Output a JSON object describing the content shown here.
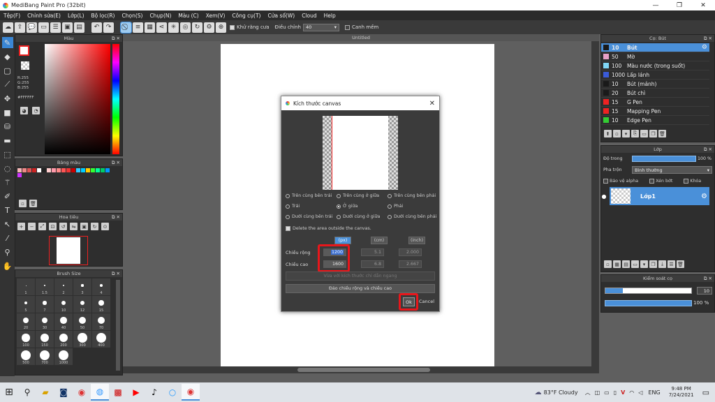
{
  "window": {
    "title": "MediBang Paint Pro (32bit)",
    "minimize": "—",
    "maximize": "❐",
    "close": "✕"
  },
  "menu": [
    "Tệp(F)",
    "Chỉnh sửa(E)",
    "Lớp(L)",
    "Bộ lọc(R)",
    "Chọn(S)",
    "Chụp(N)",
    "Màu (C)",
    "Xem(V)",
    "Công cụ(T)",
    "Cửa sổ(W)",
    "Cloud",
    "Help"
  ],
  "toolbar": {
    "antialias_label": "Khử răng cưa",
    "adjust_label": "Điều chỉnh",
    "adjust_value": "40",
    "smooth_label": "Canh mềm"
  },
  "color_panel": {
    "title": "Màu",
    "rgb": {
      "r": "R:255",
      "g": "G:255",
      "b": "B:255"
    },
    "hex": "#FFFFFF"
  },
  "palette_panel": {
    "title": "Bảng màu",
    "colors": [
      "#f4b6b6",
      "#e88",
      "#d55",
      "#c22",
      "#fff",
      "#222",
      "#fcc",
      "#f9a",
      "#f88",
      "#f55",
      "#e33",
      "#c00",
      "#3cf",
      "#0cf",
      "#fc0",
      "#3f3",
      "#0f9",
      "#0c6",
      "#09f",
      "#c3f"
    ]
  },
  "navigator_panel": {
    "title": "Hoa tiêu"
  },
  "brushsize_panel": {
    "title": "Brush Size",
    "sizes": [
      "1",
      "1.5",
      "2",
      "3",
      "4",
      "5",
      "7",
      "10",
      "12",
      "15",
      "20",
      "30",
      "40",
      "50",
      "70",
      "100",
      "150",
      "200",
      "300",
      "400",
      "500",
      "700",
      "1000"
    ]
  },
  "canvas": {
    "tab_title": "Untitled"
  },
  "brush_panel": {
    "title": "Cọ: Bút",
    "items": [
      {
        "num": "10",
        "name": "Bút",
        "color": "#1a1a1a",
        "selected": true
      },
      {
        "num": "50",
        "name": "Mờ",
        "color": "#e8a0c8",
        "selected": false
      },
      {
        "num": "100",
        "name": "Màu nước (trong suốt)",
        "color": "#7fd6f5",
        "selected": false
      },
      {
        "num": "1000",
        "name": "Lấp lánh",
        "color": "#3a5bd9",
        "selected": false
      },
      {
        "num": "10",
        "name": "Bút (mảnh)",
        "color": "#1a1a1a",
        "selected": false
      },
      {
        "num": "20",
        "name": "Bút chì",
        "color": "#1a1a1a",
        "selected": false
      },
      {
        "num": "15",
        "name": "G Pen",
        "color": "#e22",
        "selected": false
      },
      {
        "num": "15",
        "name": "Mapping Pen",
        "color": "#e22",
        "selected": false
      },
      {
        "num": "10",
        "name": "Edge Pen",
        "color": "#3c3",
        "selected": false
      }
    ]
  },
  "layer_panel": {
    "title": "Lớp",
    "opacity_label": "Độ trong",
    "opacity_value": "100 %",
    "blend_label": "Pha trộn",
    "blend_value": "Bình thường",
    "protect_alpha": "Bảo vệ alpha",
    "clipping": "Xén bớt",
    "lock": "Khóa",
    "layer_name": "Lớp1"
  },
  "brush_control": {
    "title": "Kiểm soát cọ",
    "size": "10",
    "size_fraction": 0.2,
    "opacity": "100 %"
  },
  "dialog": {
    "title": "Kích thước canvas",
    "anchors": [
      {
        "label": "Trên cùng bên trái",
        "on": false
      },
      {
        "label": "Trên cùng ở giữa",
        "on": false
      },
      {
        "label": "Trên cùng bên phải",
        "on": false
      },
      {
        "label": "Trái",
        "on": false
      },
      {
        "label": "Ở giữa",
        "on": true
      },
      {
        "label": "Phải",
        "on": false
      },
      {
        "label": "Dưới cùng bên trái",
        "on": false
      },
      {
        "label": "Dưới cùng ở giữa",
        "on": false
      },
      {
        "label": "Dưới cùng bên phải",
        "on": false
      }
    ],
    "delete_outside": "Delete the area outside the canvas.",
    "units": [
      "(px)",
      "(cm)",
      "(inch)"
    ],
    "width_label": "Chiều rộng",
    "height_label": "Chiều cao",
    "width_px": "1200",
    "width_cm": "5.1",
    "width_inch": "2.000",
    "height_px": "1600",
    "height_cm": "6.8",
    "height_inch": "2.667",
    "keep_ratio": "Vừa với kích thước chỉ dẫn ngang",
    "swap": "Đảo chiều rộng và chiều cao",
    "ok": "Ok",
    "cancel": "Cancel"
  },
  "taskbar": {
    "weather": "83°F Cloudy",
    "lang": "ENG",
    "time": "9:48 PM",
    "date": "7/24/2021"
  }
}
